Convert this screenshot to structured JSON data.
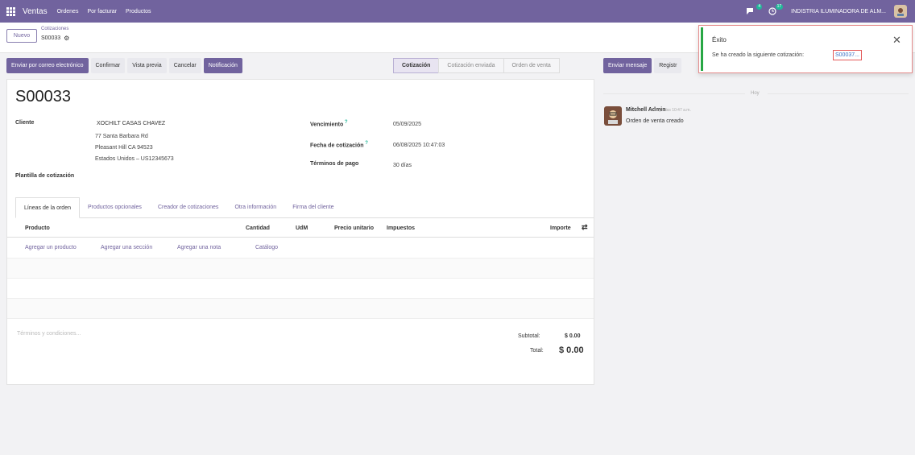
{
  "navbar": {
    "app_name": "Ventas",
    "menu": [
      "Ordenes",
      "Por facturar",
      "Productos"
    ],
    "chat_badge": "4",
    "activity_badge": "17",
    "company": "INDISTRIA ILUMINADORA DE ALM..."
  },
  "control_panel": {
    "new_label": "Nuevo",
    "breadcrumb": "Cotizaciones",
    "record_name": "S00033"
  },
  "actions": [
    "Enviar por correo electrónico",
    "Confirmar",
    "Vista previa",
    "Cancelar",
    "Notificación"
  ],
  "status_stages": [
    "Cotización",
    "Cotización enviada",
    "Orden de venta"
  ],
  "form": {
    "title": "S00033",
    "customer_label": "Cliente",
    "customer_name": "XOCHILT CASAS CHAVEZ",
    "address_1": "77 Santa Barbara Rd",
    "address_2": "Pleasant Hill CA 94523",
    "address_3": "Estados Unidos – US12345673",
    "template_label": "Plantilla de cotización",
    "expiry_label": "Vencimiento",
    "expiry_value": "05/09/2025",
    "quote_date_label": "Fecha de cotización",
    "quote_date_value": "06/08/2025 10:47:03",
    "payment_terms_label": "Términos de pago",
    "payment_terms_value": "30 días"
  },
  "tabs": [
    "Líneas de la orden",
    "Productos opcionales",
    "Creador de cotizaciones",
    "Otra información",
    "Firma del cliente"
  ],
  "lines_columns": {
    "product": "Producto",
    "quantity": "Cantidad",
    "uom": "UdM",
    "unit_price": "Precio unitario",
    "taxes": "Impuestos",
    "amount": "Importe"
  },
  "add_links": [
    "Agregar un producto",
    "Agregar una sección",
    "Agregar una nota",
    "Catálogo"
  ],
  "totals": {
    "terms_placeholder": "Términos y condiciones...",
    "subtotal_label": "Subtotal:",
    "subtotal_value": "$ 0.00",
    "total_label": "Total:",
    "total_value": "$ 0.00"
  },
  "chatter": {
    "send_message": "Enviar mensaje",
    "log_note": "Registr",
    "date_separator": "Hoy",
    "author": "Mitchell Admin",
    "time": "Hoy a las 10:47 a.m.",
    "body": "Orden de venta creado"
  },
  "toast": {
    "title": "Éxito",
    "message": "Se ha creado la siguiente cotización:",
    "link": "S00037..."
  },
  "colors": {
    "brand": "#71639e",
    "success": "#28a745",
    "badge": "#21b799"
  }
}
